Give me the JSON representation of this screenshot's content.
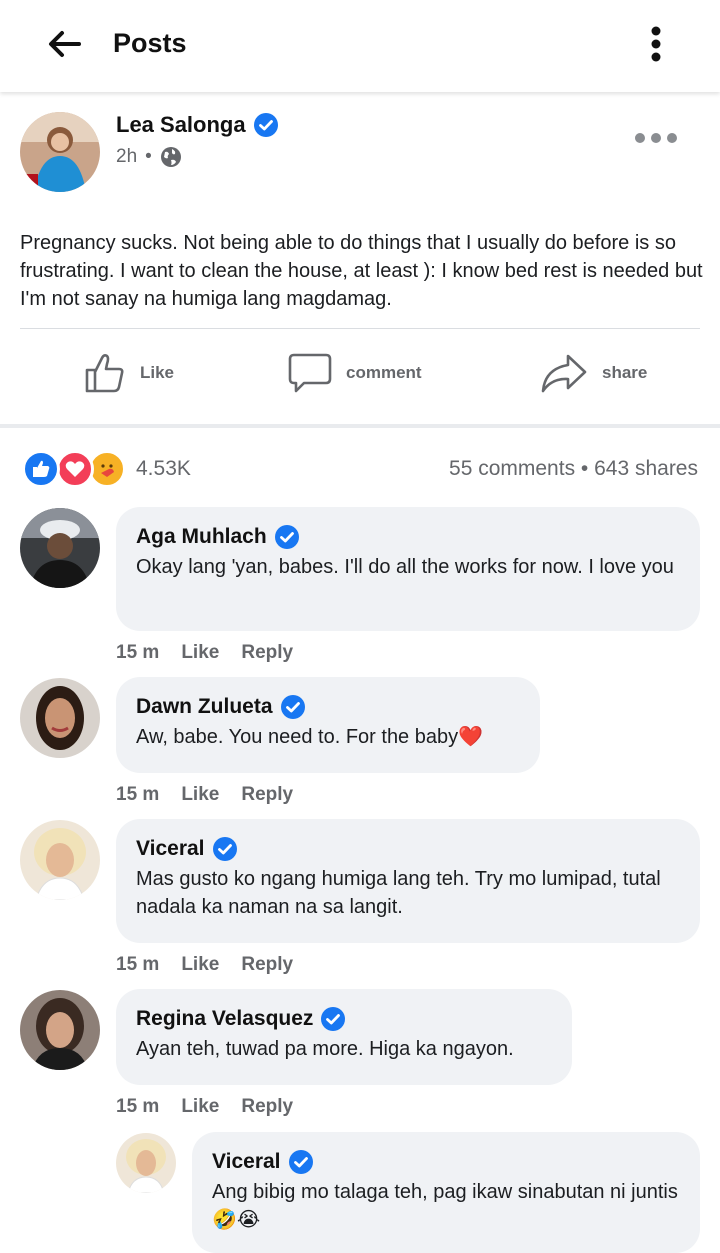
{
  "header": {
    "title": "Posts"
  },
  "post": {
    "author": "Lea Salonga",
    "time": "2h",
    "separator": "•",
    "text": "Pregnancy sucks. Not being able to do things that I usually do before is so frustrating. I want to clean the house, at least ): I know bed rest is needed but I'm not sanay na humiga lang magdamag.",
    "actions": {
      "like": "Like",
      "comment": "comment",
      "share": "share"
    },
    "reaction_count": "4.53K",
    "stats": "55 comments • 643 shares"
  },
  "comments": [
    {
      "name": "Aga Muhlach",
      "text": "Okay lang 'yan, babes. I'll do all the works for now. I love you",
      "time": "15 m",
      "like": "Like",
      "reply": "Reply"
    },
    {
      "name": "Dawn Zulueta",
      "text": "Aw, babe. You need to. For the baby❤️",
      "time": "15 m",
      "like": "Like",
      "reply": "Reply"
    },
    {
      "name": "Viceral",
      "text": "Mas gusto ko ngang humiga lang teh. Try mo lumipad, tutal nadala ka naman na sa langit.",
      "time": "15 m",
      "like": "Like",
      "reply": "Reply"
    },
    {
      "name": "Regina Velasquez",
      "text": "Ayan teh, tuwad pa more. Higa ka ngayon.",
      "time": "15 m",
      "like": "Like",
      "reply": "Reply"
    }
  ],
  "reply": {
    "name": "Viceral",
    "text": "Ang bibig mo talaga teh, pag ikaw sinabutan ni juntis🤣😭"
  },
  "colors": {
    "accent": "#1877f2",
    "bubble": "#f0f2f5",
    "muted": "#65676b"
  }
}
